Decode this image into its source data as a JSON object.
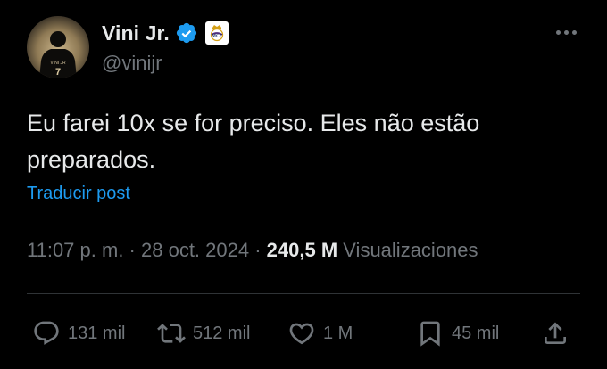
{
  "author": {
    "name": "Vini Jr.",
    "handle": "@vinijr",
    "avatar_icon": "player-jersey-avatar",
    "verified_icon": "verified-badge-icon",
    "club_badge_icon": "real-madrid-crest-icon",
    "jersey_text": "VINI JR",
    "jersey_number": "7"
  },
  "menu": {
    "icon": "more-options-icon"
  },
  "tweet": {
    "text": "Eu farei 10x se for preciso. Eles não estão preparados.",
    "translate_label": "Traducir post"
  },
  "meta": {
    "time": "11:07 p. m.",
    "separator1": " · ",
    "date": "28 oct. 2024",
    "separator2": " · ",
    "views_count": "240,5 M",
    "views_label": " Visualizaciones"
  },
  "actions": {
    "replies": {
      "icon": "reply-icon",
      "count": "131 mil"
    },
    "reposts": {
      "icon": "repost-icon",
      "count": "512 mil"
    },
    "likes": {
      "icon": "like-icon",
      "count": "1 M"
    },
    "bookmarks": {
      "icon": "bookmark-icon",
      "count": "45 mil"
    },
    "share": {
      "icon": "share-icon"
    }
  },
  "colors": {
    "background": "#000000",
    "text_primary": "#e7e9ea",
    "text_secondary": "#71767b",
    "accent": "#1d9bf0",
    "divider": "#2f3336"
  }
}
